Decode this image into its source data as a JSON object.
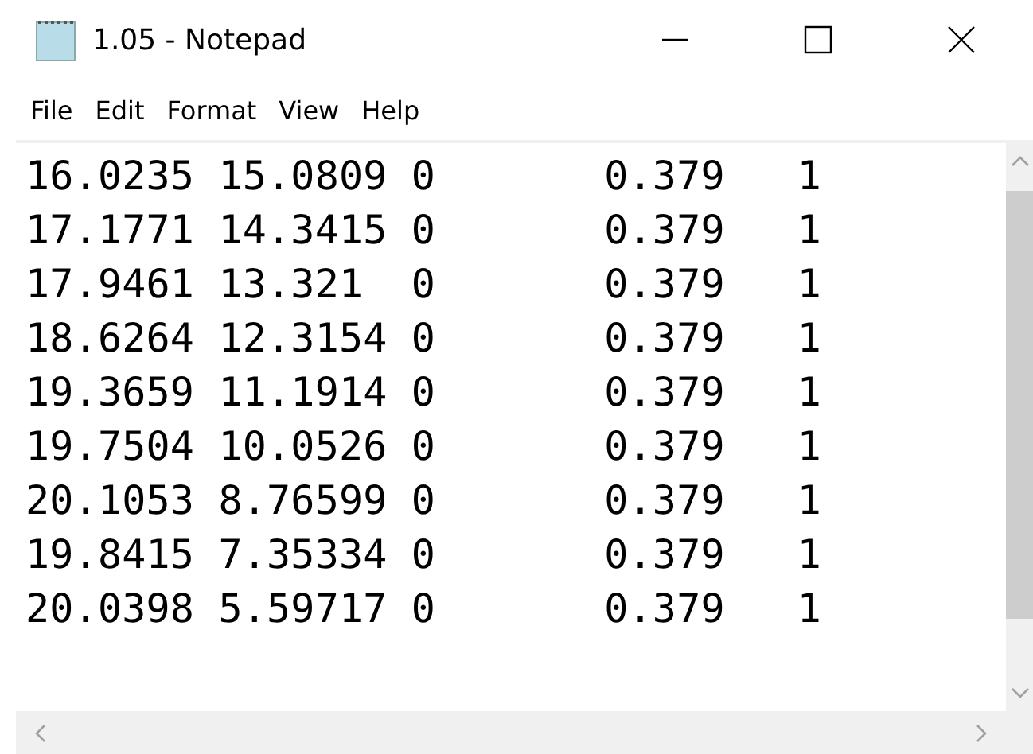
{
  "window": {
    "title": "1.05 - Notepad"
  },
  "menu": [
    "File",
    "Edit",
    "Format",
    "View",
    "Help"
  ],
  "lines": [
    "16.0235 15.0809 0       0.379   1",
    "17.1771 14.3415 0       0.379   1",
    "17.9461 13.321  0       0.379   1",
    "18.6264 12.3154 0       0.379   1",
    "19.3659 11.1914 0       0.379   1",
    "19.7504 10.0526 0       0.379   1",
    "20.1053 8.76599 0       0.379   1",
    "19.8415 7.35334 0       0.379   1",
    "20.0398 5.59717 0       0.379   1"
  ]
}
